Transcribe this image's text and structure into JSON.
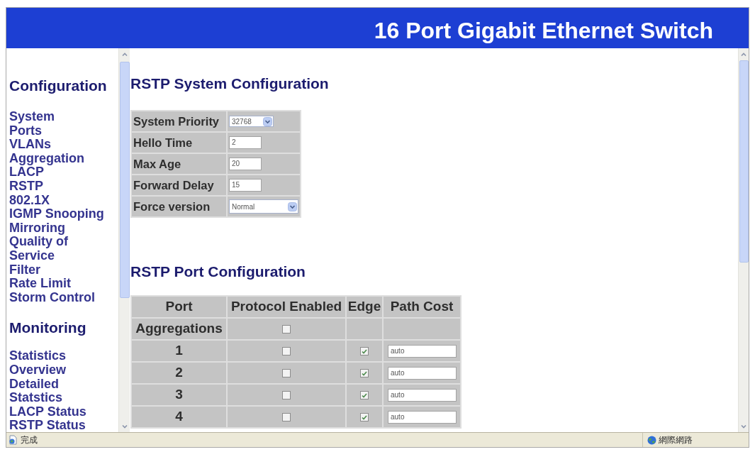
{
  "header": {
    "title": "16 Port Gigabit Ethernet Switch"
  },
  "sidebar": {
    "sections": [
      {
        "title": "Configuration",
        "links": [
          "System",
          "Ports",
          "VLANs",
          "Aggregation",
          "LACP",
          "RSTP",
          "802.1X",
          "IGMP Snooping",
          "Mirroring",
          "Quality of Service",
          "Filter",
          "Rate Limit",
          "Storm Control"
        ]
      },
      {
        "title": "Monitoring",
        "links": [
          "Statistics Overview",
          "Detailed Statstics",
          "LACP Status",
          "RSTP Status"
        ]
      }
    ]
  },
  "system_config": {
    "title": "RSTP System Configuration",
    "fields": [
      {
        "kind": "select",
        "label": "System Priority",
        "value": "32768"
      },
      {
        "kind": "input",
        "label": "Hello Time",
        "value": "2"
      },
      {
        "kind": "input",
        "label": "Max Age",
        "value": "20"
      },
      {
        "kind": "input",
        "label": "Forward Delay",
        "value": "15"
      },
      {
        "kind": "select",
        "label": "Force version",
        "value": "Normal"
      }
    ]
  },
  "port_config": {
    "title": "RSTP Port Configuration",
    "columns": [
      "Port",
      "Protocol Enabled",
      "Edge",
      "Path Cost"
    ],
    "rows": [
      {
        "port": "Aggregations",
        "protocol_enabled": false
      },
      {
        "port": "1",
        "protocol_enabled": false,
        "edge": true,
        "path_cost": "auto"
      },
      {
        "port": "2",
        "protocol_enabled": false,
        "edge": true,
        "path_cost": "auto"
      },
      {
        "port": "3",
        "protocol_enabled": false,
        "edge": true,
        "path_cost": "auto"
      },
      {
        "port": "4",
        "protocol_enabled": false,
        "edge": true,
        "path_cost": "auto"
      }
    ]
  },
  "status_bar": {
    "status": "完成",
    "zone": "網際網路"
  }
}
